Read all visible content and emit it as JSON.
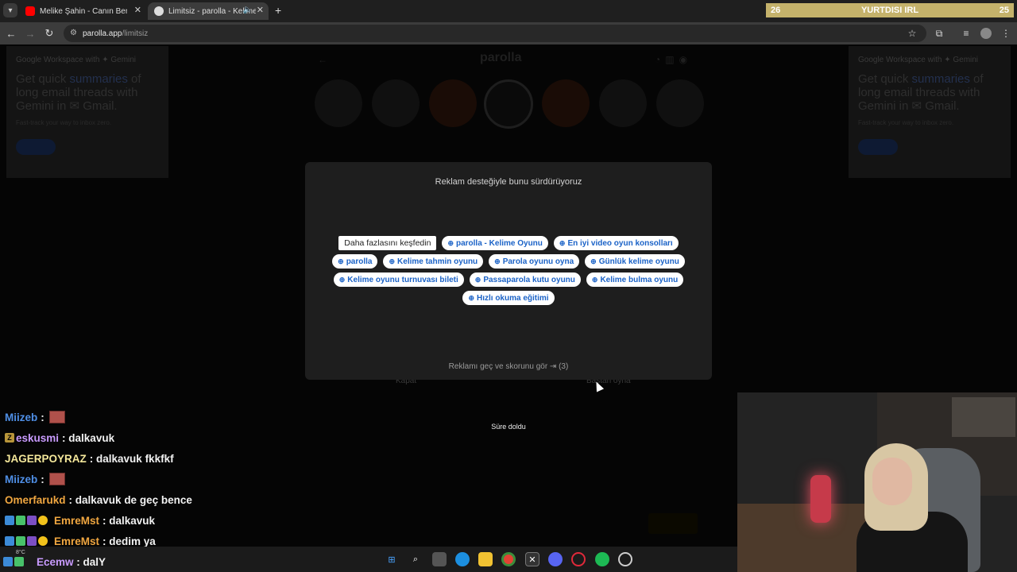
{
  "browser": {
    "tabs": [
      {
        "title": "Melike Şahin - Canın Beni Çekti",
        "favicon": "youtube-icon"
      },
      {
        "title": "Limitsiz - parolla - Kelime o",
        "favicon": "parolla-icon",
        "active": true
      }
    ],
    "url_domain": "parolla.app",
    "url_path": "/limitsiz",
    "overlay_banner": {
      "left": "26",
      "center": "YURTDISI IRL",
      "right": "25"
    }
  },
  "side_ads": {
    "brand": "Google Workspace with ✦ Gemini",
    "headline_pre": "Get quick ",
    "headline_hl": "summaries",
    "headline_post": " of long email threads with Gemini in ✉ Gmail.",
    "sub": "Fast-track your way to inbox zero."
  },
  "game": {
    "logo": "parolla",
    "btn_close": "Kapat",
    "btn_replay": "Baştan oyna"
  },
  "modal": {
    "title": "Reklam desteğiyle bunu sürdürüyoruz",
    "explore_label": "Daha fazlasını keşfedin",
    "chip_rows": [
      [
        "parolla - Kelime Oyunu",
        "En iyi video oyun konsolları"
      ],
      [
        "parolla",
        "Kelime tahmin oyunu",
        "Parola oyunu oyna",
        "Günlük kelime oyunu"
      ],
      [
        "Kelime oyunu turnuvası bileti",
        "Passaparola kutu oyunu",
        "Kelime bulma oyunu"
      ],
      [
        "Hızlı okuma eğitimi"
      ]
    ],
    "skip_text": "Reklamı geç ve skorunu gör ⇥ (3)"
  },
  "timeout_text": "Süre doldu",
  "chat": [
    {
      "user": "Miizeb",
      "color": "#4f8fe6",
      "text": "",
      "emote": true,
      "badges": []
    },
    {
      "user": "eskusmi",
      "color": "#c99bff",
      "text": "dalkavuk",
      "emote": false,
      "badges": [
        "gold"
      ]
    },
    {
      "user": "JAGERPOYRAZ",
      "color": "#f5e89b",
      "text": "dalkavuk fkkfkf",
      "emote": false,
      "badges": []
    },
    {
      "user": "Miizeb",
      "color": "#4f8fe6",
      "text": "",
      "emote": true,
      "badges": []
    },
    {
      "user": "Omerfarukd",
      "color": "#f0a640",
      "text": "dalkavuk de geç bence",
      "emote": false,
      "badges": []
    },
    {
      "user": "EmreMst",
      "color": "#f0a640",
      "text": "dalkavuk",
      "emote": false,
      "badges": [
        "blue",
        "green",
        "purple",
        "yellow"
      ]
    },
    {
      "user": "EmreMst",
      "color": "#f0a640",
      "text": "dedim ya",
      "emote": false,
      "badges": [
        "blue",
        "green",
        "purple",
        "yellow"
      ]
    },
    {
      "user": "Ecemw",
      "color": "#c99bff",
      "text": "dalY",
      "emote": false,
      "badges": [
        "blue",
        "green"
      ]
    }
  ],
  "taskbar": {
    "weather": "8°C",
    "apps": [
      "windows-start-icon",
      "search-icon",
      "task-view-icon",
      "edge-icon",
      "file-explorer-icon",
      "chrome-icon",
      "x-icon",
      "discord-icon",
      "opera-icon",
      "spotify-icon",
      "app-icon"
    ]
  }
}
